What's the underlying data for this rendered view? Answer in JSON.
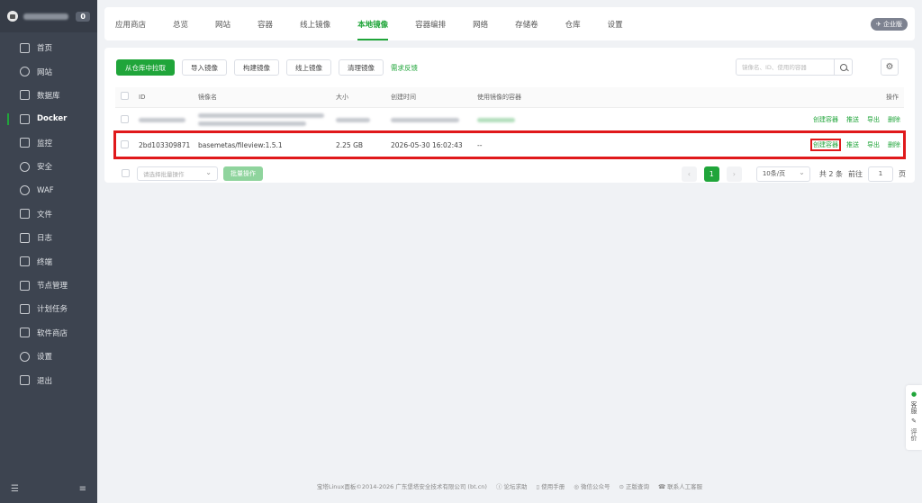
{
  "sidebar": {
    "badge": "0",
    "items": [
      {
        "label": "首页"
      },
      {
        "label": "网站"
      },
      {
        "label": "数据库"
      },
      {
        "label": "Docker"
      },
      {
        "label": "监控"
      },
      {
        "label": "安全"
      },
      {
        "label": "WAF"
      },
      {
        "label": "文件"
      },
      {
        "label": "日志"
      },
      {
        "label": "终端"
      },
      {
        "label": "节点管理"
      },
      {
        "label": "计划任务"
      },
      {
        "label": "软件商店"
      },
      {
        "label": "设置"
      },
      {
        "label": "退出"
      }
    ]
  },
  "tabs": [
    "应用商店",
    "总览",
    "网站",
    "容器",
    "线上镜像",
    "本地镜像",
    "容器编排",
    "网络",
    "存储卷",
    "仓库",
    "设置"
  ],
  "enterprise_badge": "企业版",
  "toolbar": {
    "pull": "从仓库中拉取",
    "import": "导入镜像",
    "build": "构建镜像",
    "online": "线上镜像",
    "clean": "清理镜像",
    "feedback": "需求反馈",
    "search_placeholder": "镜像名、ID、使用的容器"
  },
  "table": {
    "headers": [
      "ID",
      "镜像名",
      "大小",
      "创建时间",
      "使用镜像的容器",
      "操作"
    ],
    "rows": [
      {
        "id": "",
        "name": "",
        "size": "",
        "created": "",
        "containers": ""
      },
      {
        "id": "2bd103309871",
        "name": "basemetas/fileview:1.5.1",
        "size": "2.25 GB",
        "created": "2026-05-30 16:02:43",
        "containers": "--"
      }
    ],
    "ops": [
      "创建容器",
      "推送",
      "导出",
      "删除"
    ]
  },
  "batch": {
    "select_placeholder": "请选择批量操作",
    "button": "批量操作"
  },
  "pager": {
    "current": "1",
    "page_size": "10条/页",
    "total": "共 2 条",
    "goto_label": "前往",
    "goto_value": "1",
    "page_unit": "页"
  },
  "footer": {
    "copyright": "宝塔Linux面板©2014-2026 广东堡塔安全技术有限公司 (bt.cn)",
    "links": [
      "论坛求助",
      "使用手册",
      "微信公众号",
      "正版查询",
      "联系人工客服"
    ]
  },
  "float": [
    "客服",
    "评价"
  ]
}
